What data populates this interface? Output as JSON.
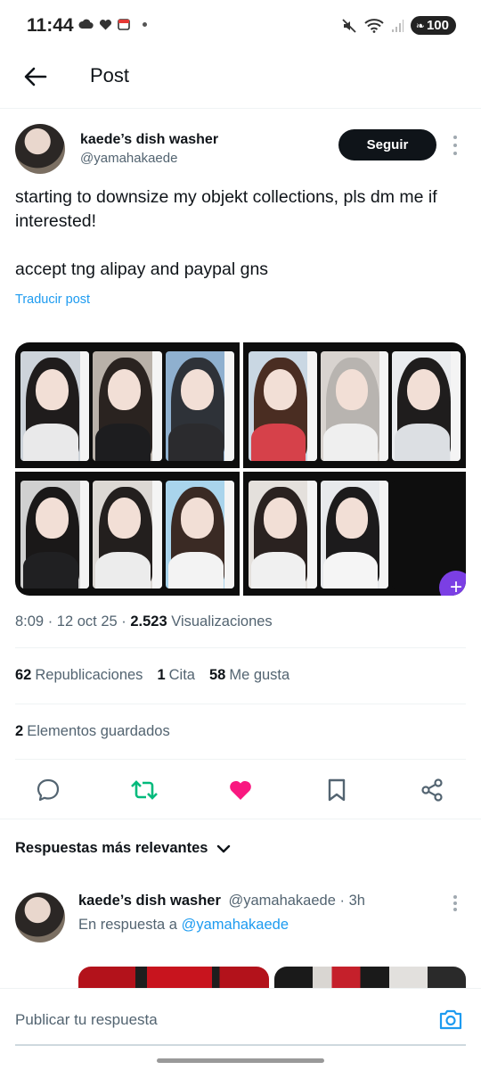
{
  "status_bar": {
    "time": "11:44",
    "battery": "100"
  },
  "header": {
    "title": "Post"
  },
  "post": {
    "author_name": "kaede’s dish washer",
    "author_handle": "@yamahakaede",
    "follow_label": "Seguir",
    "text": "starting to downsize my objekt collections, pls dm me if interested!\n\naccept tng alipay and paypal gns",
    "translate_label": "Traducir post",
    "time": "8:09",
    "date": "12 oct 25",
    "views_count": "2.523",
    "views_label": "Visualizaciones"
  },
  "stats": {
    "reposts_count": "62",
    "reposts_label": "Republicaciones",
    "quotes_count": "1",
    "quotes_label": "Cita",
    "likes_count": "58",
    "likes_label": "Me gusta",
    "saves_count": "2",
    "saves_label": "Elementos guardados"
  },
  "actions": {
    "reply_icon": "speech-bubble-icon",
    "repost_icon": "repost-icon",
    "like_icon": "heart-icon",
    "bookmark_icon": "bookmark-icon",
    "share_icon": "share-icon",
    "repost_color": "#00ba7c",
    "like_color": "#f91880"
  },
  "replies": {
    "sort_label": "Respuestas más relevantes",
    "items": [
      {
        "author_name": "kaede’s dish washer",
        "author_handle": "@yamahakaede",
        "time_ago": "3h",
        "reply_to_prefix": "En respuesta a",
        "reply_to_handle": "@yamahakaede"
      }
    ]
  },
  "compose": {
    "placeholder": "Publicar tu respuesta"
  },
  "colors": {
    "accent": "#1d9bf0",
    "text_primary": "#0f1419",
    "text_secondary": "#536471"
  }
}
